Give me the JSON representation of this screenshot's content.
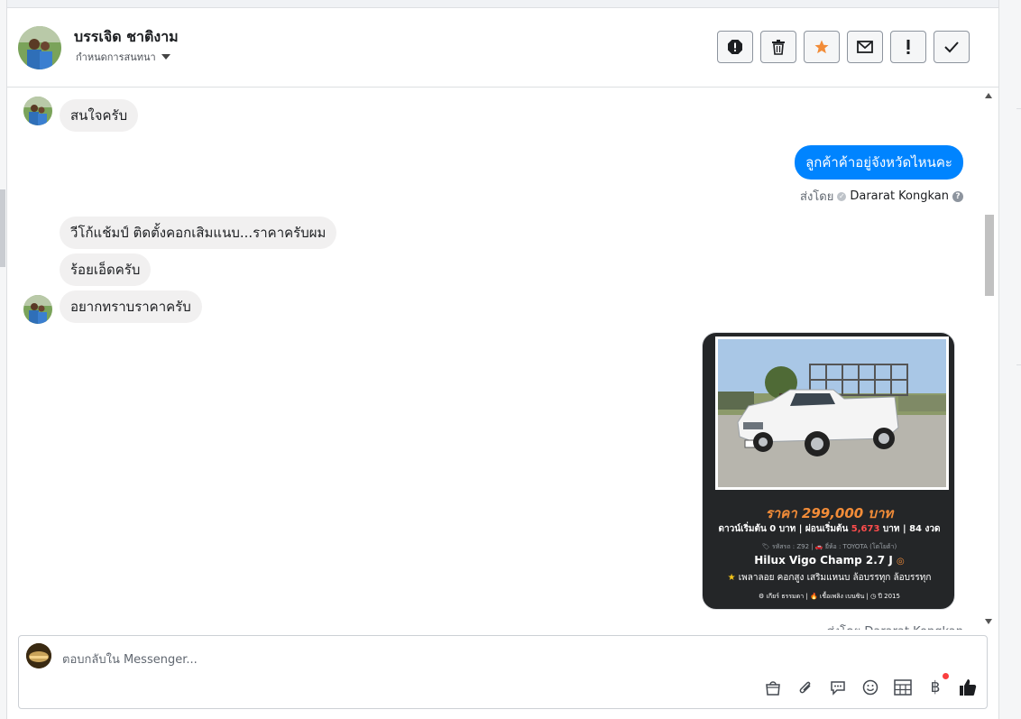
{
  "header": {
    "contact_name": "บรรเจิด ชาติงาม",
    "conversation_menu": "กำหนดการสนทนา",
    "actions": [
      {
        "name": "report-button",
        "icon": "alert-octagon-icon",
        "glyph": "!"
      },
      {
        "name": "delete-button",
        "icon": "trash-icon",
        "glyph": "🗑"
      },
      {
        "name": "star-button",
        "icon": "star-icon",
        "glyph": "★"
      },
      {
        "name": "mark-unread-button",
        "icon": "envelope-icon",
        "glyph": "✉"
      },
      {
        "name": "mark-important-button",
        "icon": "exclamation-icon",
        "glyph": "!"
      },
      {
        "name": "mark-done-button",
        "icon": "check-icon",
        "glyph": "✓"
      }
    ]
  },
  "messages": {
    "m1": "สนใจครับ",
    "m2": "ลูกค้าค้าอยู่จังหวัดไหนคะ",
    "sent_by_label": "ส่งโดย",
    "sent_by_name": "Dararat Kongkan",
    "m3": "วีโก้แช้มป์ ติดตั้งคอกเสิมแนบ...ราคาครับผม",
    "m4": "ร้อยเอ็ดครับ",
    "m5": "อยากทราบราคาครับ"
  },
  "ad_card": {
    "price": "ราคา 299,000 บาท",
    "terms_before": "ดาวน์เริ่มต้น 0 บาท | ผ่อนเริ่มต้น",
    "monthly": "5,673",
    "terms_after": "บาท | 84 งวด",
    "meta": "🏷 รหัสรถ : Z92 | 🚗 ยี่ห้อ : TOYOTA (โตโยต้า)",
    "model": "Hilux Vigo Champ 2.7 J",
    "features": "เพลาลอย คอกสูง เสริมแหนบ ล้อบรรทุก ล้อบรรทุก",
    "specs": "⚙ เกียร์ ธรรมดา   |   🔥 เชื้อเพลิง เบนซิน   |   ◷ ปี 2015"
  },
  "composer": {
    "placeholder": "ตอบกลับใน Messenger...",
    "tools": [
      {
        "name": "shop-bag-icon",
        "glyph": "🛍"
      },
      {
        "name": "attach-icon",
        "glyph": "📎"
      },
      {
        "name": "saved-reply-icon",
        "glyph": "💬"
      },
      {
        "name": "emoji-icon",
        "glyph": "☺"
      },
      {
        "name": "table-icon",
        "glyph": "▦"
      },
      {
        "name": "baht-icon",
        "glyph": "฿"
      },
      {
        "name": "thumbs-up-icon",
        "glyph": "👍"
      }
    ]
  },
  "colors": {
    "accent": "#0084ff",
    "price_orange": "#f28c38",
    "monthly_red": "#ff4d4d",
    "card_bg": "#242628"
  }
}
